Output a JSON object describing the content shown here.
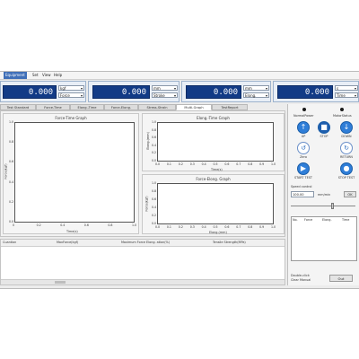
{
  "menu": [
    "Equipment",
    "Set",
    "View",
    "Help"
  ],
  "displays": [
    {
      "value": "0.000",
      "unit": "kgf",
      "mode": "Force"
    },
    {
      "value": "0.000",
      "unit": "mm",
      "mode": "Stroke"
    },
    {
      "value": "0.000",
      "unit": "mm",
      "mode": "Elong."
    },
    {
      "value": "0.000",
      "unit": "s",
      "mode": "Time"
    }
  ],
  "tabs": [
    "Test Standard",
    "Force-Time",
    "Elong.-Time",
    "Force-Elong.",
    "Stress-Strain",
    "Multi-Graph",
    "TestReport"
  ],
  "active_tab": "Multi-Graph",
  "graphs": {
    "force_time": {
      "title": "Force-Time Graph",
      "xlabel": "Time(s)",
      "ylabel": "Force(kgf)",
      "yticks": [
        "1.0",
        "0.8",
        "0.6",
        "0.4",
        "0.2",
        "0.0"
      ],
      "xticks": [
        "0",
        "0.2",
        "0.4",
        "0.6",
        "0.8",
        "1.0"
      ]
    },
    "elong_time": {
      "title": "Elong.-Time Graph",
      "xlabel": "Time(s)",
      "ylabel": "Elong.(mm)",
      "yticks": [
        "1.0",
        "0.8",
        "0.6",
        "0.4",
        "0.2",
        "0.0"
      ],
      "xticks": [
        "0.0",
        "0.1",
        "0.2",
        "0.3",
        "0.4",
        "0.5",
        "0.6",
        "0.7",
        "0.8",
        "0.9",
        "1.0"
      ]
    },
    "force_elong": {
      "title": "Force-Elong. Graph",
      "xlabel": "Elong.(mm)",
      "ylabel": "Force(kgf)",
      "yticks": [
        "1.0",
        "0.8",
        "0.6",
        "0.4",
        "0.2",
        "0.0"
      ],
      "xticks": [
        "0.0",
        "0.1",
        "0.2",
        "0.3",
        "0.4",
        "0.5",
        "0.6",
        "0.7",
        "0.8",
        "0.9",
        "1.0"
      ]
    }
  },
  "results_headers": [
    "Cuantion",
    "MaxForce(kgf)",
    "Maximum Force Elong. ation(%)",
    "Tensile Strength(MPa)"
  ],
  "control": {
    "led1_label": "NormalPower",
    "led2_label": "MotorStatus",
    "buttons": [
      {
        "label": "UP",
        "glyph": "↑"
      },
      {
        "label": "STOP",
        "glyph": "■"
      },
      {
        "label": "DOWN",
        "glyph": "↓"
      },
      {
        "label": "Zero",
        "glyph": "↺"
      },
      {
        "label": "RETURN",
        "glyph": "↻"
      },
      {
        "label": "START TEST",
        "glyph": "▶"
      },
      {
        "label": "STOP TEST",
        "glyph": "●"
      }
    ],
    "speed_label": "Speed control",
    "speed_value": "100.00",
    "speed_unit": "mm/min",
    "ok_label": "OK",
    "list_headers": [
      "No.",
      "Force",
      "Elong.",
      "Time"
    ],
    "bottom_left_1": "Double-click",
    "bottom_left_2": "Clear Manual",
    "exit_label": "Out"
  }
}
